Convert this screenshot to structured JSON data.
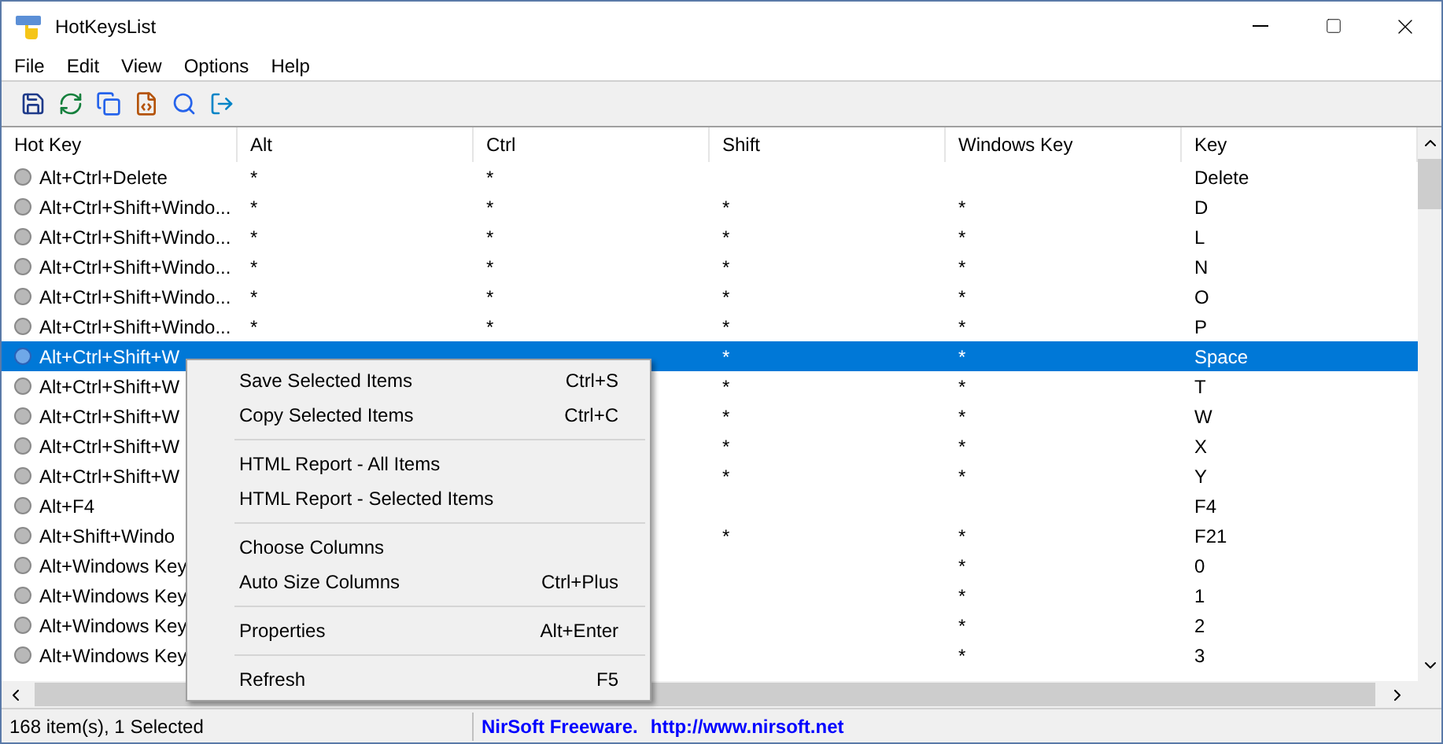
{
  "window": {
    "title": "HotKeysList"
  },
  "menu_bar": [
    "File",
    "Edit",
    "View",
    "Options",
    "Help"
  ],
  "table": {
    "columns": [
      "Hot Key",
      "Alt",
      "Ctrl",
      "Shift",
      "Windows Key",
      "Key"
    ],
    "rows": [
      {
        "cells": [
          "Alt+Ctrl+Delete",
          "*",
          "*",
          "",
          "",
          "Delete"
        ],
        "selected": false
      },
      {
        "cells": [
          "Alt+Ctrl+Shift+Windo...",
          "*",
          "*",
          "*",
          "*",
          "D"
        ],
        "selected": false
      },
      {
        "cells": [
          "Alt+Ctrl+Shift+Windo...",
          "*",
          "*",
          "*",
          "*",
          "L"
        ],
        "selected": false
      },
      {
        "cells": [
          "Alt+Ctrl+Shift+Windo...",
          "*",
          "*",
          "*",
          "*",
          "N"
        ],
        "selected": false
      },
      {
        "cells": [
          "Alt+Ctrl+Shift+Windo...",
          "*",
          "*",
          "*",
          "*",
          "O"
        ],
        "selected": false
      },
      {
        "cells": [
          "Alt+Ctrl+Shift+Windo...",
          "*",
          "*",
          "*",
          "*",
          "P"
        ],
        "selected": false
      },
      {
        "cells": [
          "Alt+Ctrl+Shift+W",
          "",
          "",
          "*",
          "*",
          "Space"
        ],
        "selected": true
      },
      {
        "cells": [
          "Alt+Ctrl+Shift+W",
          "",
          "",
          "*",
          "*",
          "T"
        ],
        "selected": false
      },
      {
        "cells": [
          "Alt+Ctrl+Shift+W",
          "",
          "",
          "*",
          "*",
          "W"
        ],
        "selected": false
      },
      {
        "cells": [
          "Alt+Ctrl+Shift+W",
          "",
          "",
          "*",
          "*",
          "X"
        ],
        "selected": false
      },
      {
        "cells": [
          "Alt+Ctrl+Shift+W",
          "",
          "",
          "*",
          "*",
          "Y"
        ],
        "selected": false
      },
      {
        "cells": [
          "Alt+F4",
          "",
          "",
          "",
          "",
          "F4"
        ],
        "selected": false
      },
      {
        "cells": [
          "Alt+Shift+Windo",
          "",
          "",
          "*",
          "*",
          "F21"
        ],
        "selected": false
      },
      {
        "cells": [
          "Alt+Windows Key",
          "",
          "",
          "",
          "*",
          "0"
        ],
        "selected": false
      },
      {
        "cells": [
          "Alt+Windows Key",
          "",
          "",
          "",
          "*",
          "1"
        ],
        "selected": false
      },
      {
        "cells": [
          "Alt+Windows Key",
          "",
          "",
          "",
          "*",
          "2"
        ],
        "selected": false
      },
      {
        "cells": [
          "Alt+Windows Key",
          "",
          "",
          "",
          "*",
          "3"
        ],
        "selected": false
      }
    ]
  },
  "context_menu": [
    {
      "kind": "item",
      "label": "Save Selected Items",
      "shortcut": "Ctrl+S"
    },
    {
      "kind": "item",
      "label": "Copy Selected Items",
      "shortcut": "Ctrl+C"
    },
    {
      "kind": "separator"
    },
    {
      "kind": "item",
      "label": "HTML Report - All Items"
    },
    {
      "kind": "item",
      "label": "HTML Report - Selected Items"
    },
    {
      "kind": "separator"
    },
    {
      "kind": "item",
      "label": "Choose Columns"
    },
    {
      "kind": "item",
      "label": "Auto Size Columns",
      "shortcut": "Ctrl+Plus"
    },
    {
      "kind": "separator"
    },
    {
      "kind": "item",
      "label": "Properties",
      "shortcut": "Alt+Enter"
    },
    {
      "kind": "separator"
    },
    {
      "kind": "item",
      "label": "Refresh",
      "shortcut": "F5"
    }
  ],
  "status_bar": {
    "count": "168 item(s), 1 Selected",
    "credit": "NirSoft Freeware.",
    "link": "http://www.nirsoft.net"
  }
}
